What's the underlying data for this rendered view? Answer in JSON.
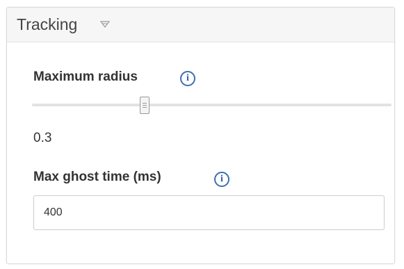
{
  "panel": {
    "title": "Tracking",
    "toggle_icon": "chevron-down-icon"
  },
  "fields": {
    "max_radius": {
      "label": "Maximum radius",
      "info_icon": "info-icon",
      "info_glyph": "i",
      "value": "0.3",
      "slider_position_fraction": 0.3
    },
    "max_ghost_time": {
      "label": "Max ghost time (ms)",
      "info_icon": "info-icon",
      "info_glyph": "i",
      "value": "400"
    }
  },
  "colors": {
    "info_icon": "#3a6fb3",
    "header_bg": "#f6f6f6",
    "border": "#d9d9d9"
  }
}
